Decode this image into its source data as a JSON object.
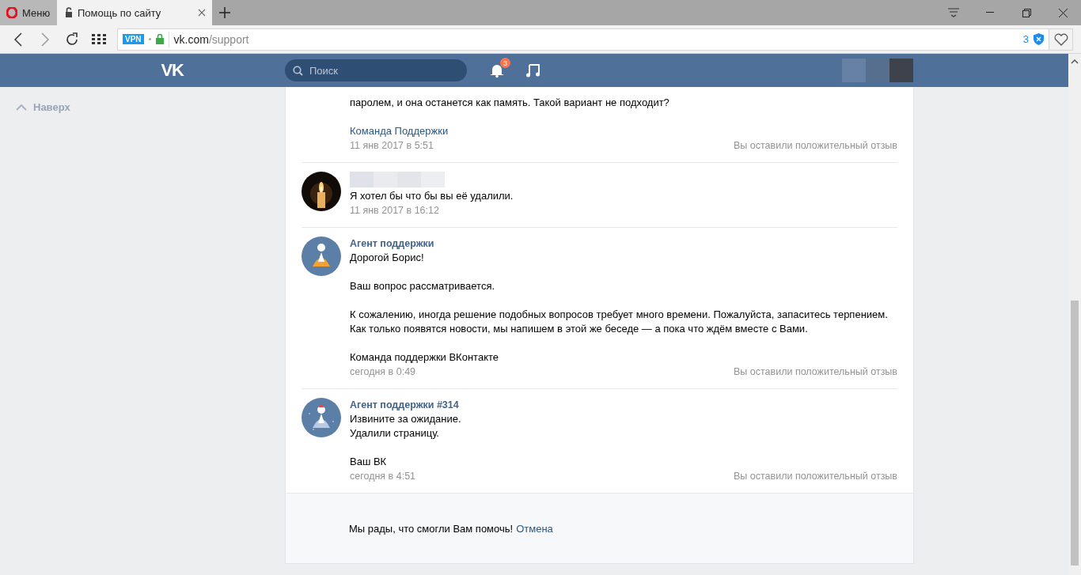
{
  "browser": {
    "menu_label": "Меню",
    "tabs": [
      {
        "title": "Помощь по сайту",
        "selected": true
      }
    ],
    "address": {
      "vpn": "VPN",
      "host": "vk.com",
      "path": "/support",
      "blocked_count": "3"
    }
  },
  "header": {
    "logo": "VK",
    "search_placeholder": "Поиск",
    "notifications": "3"
  },
  "sidebar": {
    "back_to_top": "Наверх"
  },
  "messages": [
    {
      "kind": "continued",
      "paragraphs": [
        [
          "паролем, и она останется как память. Такой вариант не подходит?"
        ]
      ],
      "signature": {
        "text": "Команда Поддержки",
        "link": true
      },
      "time": "11 янв 2017 в 5:51",
      "feedback": "Вы оставили положительный отзыв"
    },
    {
      "kind": "user",
      "paragraphs": [
        [
          "Я хотел бы что бы вы её удалили."
        ]
      ],
      "time": "11 янв 2017 в 16:12"
    },
    {
      "kind": "agent",
      "author": "Агент поддержки",
      "paragraphs": [
        [
          "Дорогой Борис!"
        ],
        [
          "Ваш вопрос рассматривается."
        ],
        [
          "К сожалению, иногда решение подобных вопросов требует много времени. Пожалуйста, запаситесь терпением. Как только появятся новости, мы напишем в этой же беседе — а пока что ждём вместе с Вами."
        ]
      ],
      "signature": {
        "text": "Команда поддержки ВКонтакте",
        "link": false
      },
      "time": "сегодня в 0:49",
      "feedback": "Вы оставили положительный отзыв"
    },
    {
      "kind": "agent_winter",
      "author": "Агент поддержки #314",
      "paragraphs": [
        [
          "Извините за ожидание.",
          "Удалили страницу."
        ],
        [
          "Ваш ВК"
        ]
      ],
      "time": "сегодня в 4:51",
      "feedback": "Вы оставили положительный отзыв"
    }
  ],
  "footer": {
    "text": "Мы рады, что смогли Вам помочь!",
    "link": "Отмена"
  }
}
